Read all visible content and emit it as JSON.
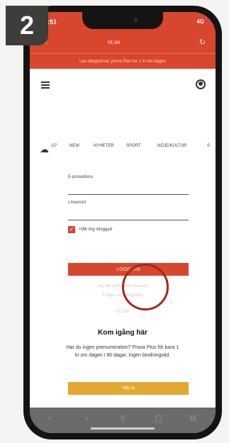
{
  "step": {
    "number": "2"
  },
  "status_bar": {
    "time": "3:51",
    "system": "4G"
  },
  "browser": {
    "aa_label": "aA",
    "url": "nt.se",
    "reload_icon": "reload-icon"
  },
  "banner": {
    "text": "Las obegransat, prova Plus for 1 kr om dagen"
  },
  "header": {
    "menu_icon": "hamburger-menu-icon",
    "account_icon": "user-icon"
  },
  "nav": {
    "weather_icon": "cloud-icon",
    "temperature": "15°",
    "items": [
      "NEW",
      "NYHETER",
      "SPORT",
      "NÖJE/KULTUR",
      "S"
    ]
  },
  "login": {
    "email_label": "E-postadress",
    "password_label": "Lösenord",
    "remember_label": "Håll mig inloggad",
    "submit_label": "LOGGA IN",
    "forgot_password": "Jag har glömt mitt lösenord",
    "help_link": "Frågor om inloggning",
    "create_account": "ELLER"
  },
  "signup": {
    "title": "Kom igång här",
    "body": "Har du ingen prenumeration? Prova Plus för bara 1 kr om dagen i 90 dagar. Ingen bindningstid.",
    "button_label": "Välj nu"
  },
  "toolbar": {
    "items": [
      "back-icon",
      "forward-icon",
      "share-icon",
      "bookmarks-icon",
      "tabs-icon"
    ]
  },
  "colors": {
    "accent": "#d8462e",
    "cta": "#e3a832",
    "highlight": "#9e2a22"
  }
}
